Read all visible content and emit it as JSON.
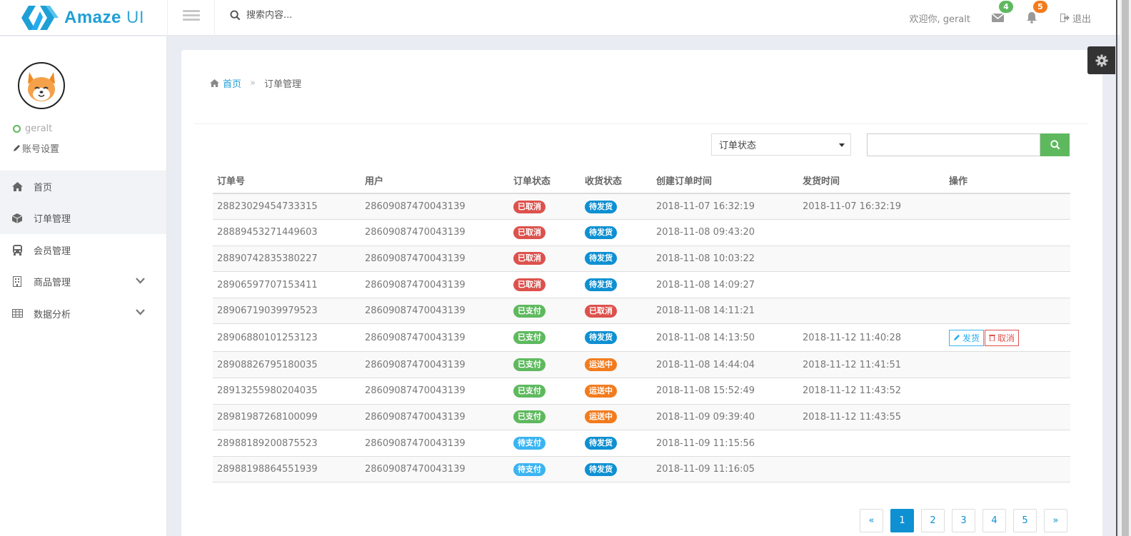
{
  "brand": {
    "name_bold": "Amaze",
    "name_rest": "UI"
  },
  "header": {
    "search_placeholder": "搜索内容...",
    "welcome": "欢迎你, geralt",
    "messages_count": "4",
    "notifications_count": "5",
    "logout_label": "退出"
  },
  "sidebar": {
    "username": "geralt",
    "account_settings": "账号设置",
    "items": [
      {
        "label": "首页",
        "icon": "home-icon"
      },
      {
        "label": "订单管理",
        "icon": "cube-icon"
      },
      {
        "label": "会员管理",
        "icon": "bus-icon"
      },
      {
        "label": "商品管理",
        "icon": "building-icon"
      },
      {
        "label": "数据分析",
        "icon": "table-icon"
      }
    ]
  },
  "breadcrumb": {
    "home": "首页",
    "sep": "»",
    "current": "订单管理"
  },
  "filter": {
    "status_label": "订单状态",
    "search_value": ""
  },
  "table": {
    "headers": [
      "订单号",
      "用户",
      "订单状态",
      "收货状态",
      "创建订单时间",
      "发货时间",
      "操作"
    ],
    "rows": [
      [
        "28823029454733315",
        "28609087470043139",
        "已取消",
        "待发货",
        "2018-11-07 16:32:19",
        "2018-11-07 16:32:19"
      ],
      [
        "28889453271449603",
        "28609087470043139",
        "已取消",
        "待发货",
        "2018-11-08 09:43:20",
        ""
      ],
      [
        "28890742835380227",
        "28609087470043139",
        "已取消",
        "待发货",
        "2018-11-08 10:03:22",
        ""
      ],
      [
        "28906597707153411",
        "28609087470043139",
        "已取消",
        "待发货",
        "2018-11-08 14:09:27",
        ""
      ],
      [
        "28906719039979523",
        "28609087470043139",
        "已支付",
        "已取消",
        "2018-11-08 14:11:21",
        ""
      ],
      [
        "28906880101253123",
        "28609087470043139",
        "已支付",
        "待发货",
        "2018-11-08 14:13:50",
        "2018-11-12 11:40:28"
      ],
      [
        "28908826795180035",
        "28609087470043139",
        "已支付",
        "运送中",
        "2018-11-08 14:44:04",
        "2018-11-12 11:41:51"
      ],
      [
        "28913255980204035",
        "28609087470043139",
        "已支付",
        "运送中",
        "2018-11-08 15:52:49",
        "2018-11-12 11:43:52"
      ],
      [
        "28981987268100099",
        "28609087470043139",
        "已支付",
        "运送中",
        "2018-11-09 09:39:40",
        "2018-11-12 11:43:55"
      ],
      [
        "28988189200875523",
        "28609087470043139",
        "待支付",
        "待发货",
        "2018-11-09 11:15:56",
        ""
      ],
      [
        "28988198864551939",
        "28609087470043139",
        "待支付",
        "待发货",
        "2018-11-09 11:16:05",
        ""
      ]
    ],
    "actions": {
      "ship": "发货",
      "cancel": "取消"
    }
  },
  "status_colors": {
    "已取消": "#dd514c",
    "待发货": "#0e90d2",
    "已支付": "#5eb95e",
    "运送中": "#f37b1d",
    "待支付": "#3bb4f2"
  },
  "pagination": {
    "prev": "«",
    "pages": [
      "1",
      "2",
      "3",
      "4",
      "5"
    ],
    "next": "»",
    "current": "1"
  }
}
